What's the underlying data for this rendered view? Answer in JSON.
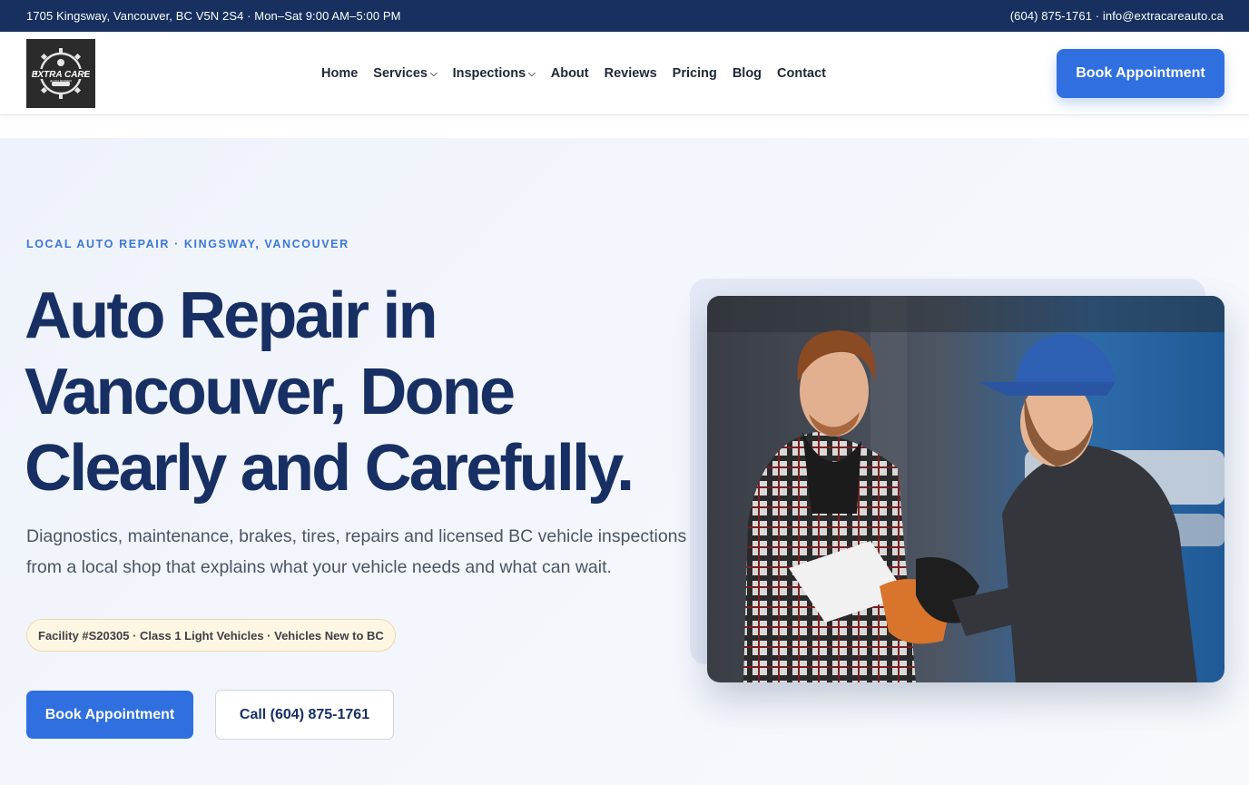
{
  "topbar": {
    "address_hours": "1705 Kingsway, Vancouver, BC V5N 2S4 · Mon–Sat 9:00 AM–5:00 PM",
    "contact": "(604) 875-1761 · info@extracareauto.ca"
  },
  "logo": {
    "line1": "EXTRA CARE",
    "line2": "AUTO REPAIR"
  },
  "nav": {
    "items": [
      {
        "label": "Home",
        "has_dropdown": false
      },
      {
        "label": "Services",
        "has_dropdown": true
      },
      {
        "label": "Inspections",
        "has_dropdown": true
      },
      {
        "label": "About",
        "has_dropdown": false
      },
      {
        "label": "Reviews",
        "has_dropdown": false
      },
      {
        "label": "Pricing",
        "has_dropdown": false
      },
      {
        "label": "Blog",
        "has_dropdown": false
      },
      {
        "label": "Contact",
        "has_dropdown": false
      }
    ],
    "chevron_glyph": "⌵",
    "cta_label": "Book Appointment"
  },
  "hero": {
    "eyebrow": "LOCAL AUTO REPAIR · KINGSWAY, VANCOUVER",
    "headline": "Auto Repair in Vancouver, Done Clearly and Carefully.",
    "subtext": "Diagnostics, maintenance, brakes, tires, repairs and licensed BC vehicle inspections from a local shop that explains what your vehicle needs and what can wait.",
    "badge": "Facility #S20305 · Class 1 Light Vehicles · Vehicles New to BC",
    "primary_button": "Book Appointment",
    "secondary_button": "Call (604) 875-1761"
  },
  "colors": {
    "topbar_bg": "#17305f",
    "accent_blue": "#2f6fe0",
    "headline_navy": "#172f63",
    "eyebrow_blue": "#3b78d8",
    "badge_bg": "#fdf6e3"
  },
  "icons": {
    "dropdown": "chevron-down-icon",
    "logo": "gear-logo-icon"
  }
}
